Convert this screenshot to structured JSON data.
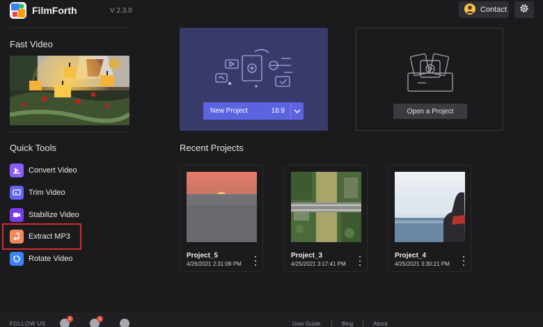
{
  "app": {
    "name": "FilmForth",
    "version": "V 2.3.0"
  },
  "topbar": {
    "contact_label": "Contact",
    "contact_icon": "person-avatar-icon",
    "settings_icon": "gear-icon"
  },
  "sidebar": {
    "fast_video_title": "Fast Video",
    "quick_tools_title": "Quick Tools",
    "tools": [
      {
        "label": "Convert Video",
        "icon": "convert-video-icon",
        "color": "#8b5cf6"
      },
      {
        "label": "Trim Video",
        "icon": "trim-video-icon",
        "color": "#6366f1"
      },
      {
        "label": "Stabilize Video",
        "icon": "stabilize-video-icon",
        "color": "#7c3aed"
      },
      {
        "label": "Extract MP3",
        "icon": "extract-mp3-icon",
        "color": "#f08a5d",
        "highlighted": true
      },
      {
        "label": "Rotate Video",
        "icon": "rotate-video-icon",
        "color": "#3b82f6"
      }
    ]
  },
  "main": {
    "new_project": {
      "label": "New Project",
      "ratio": "16:9"
    },
    "open_project": {
      "label": "Open a Project"
    },
    "recent_title": "Recent Projects",
    "projects": [
      {
        "name": "Project_5",
        "date": "4/26/2021 2:31:09 PM",
        "thumb": "sunset-over-sea"
      },
      {
        "name": "Project_3",
        "date": "4/25/2021 3:17:41 PM",
        "thumb": "aerial-canal-bridge"
      },
      {
        "name": "Project_4",
        "date": "4/25/2021 3:30:21 PM",
        "thumb": "woman-by-sea"
      }
    ]
  },
  "footer": {
    "follow_label": "FOLLOW US",
    "social": [
      {
        "icon": "instagram-icon",
        "badge": "2"
      },
      {
        "icon": "facebook-icon",
        "badge": "1"
      },
      {
        "icon": "twitter-icon",
        "badge": ""
      }
    ],
    "links": [
      "User Guide",
      "Blog",
      "About"
    ]
  },
  "colors": {
    "accent": "#5c63e0",
    "new_card_bg": "#383a6a",
    "highlight_border": "#d62b2b"
  }
}
